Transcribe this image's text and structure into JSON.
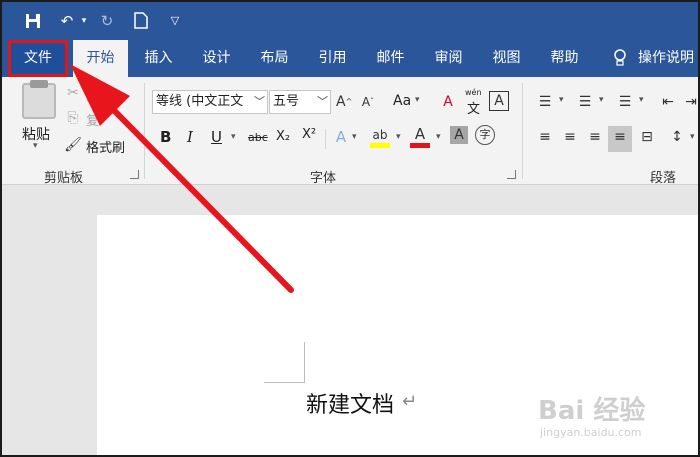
{
  "quick_access": {
    "save_icon": "save-icon",
    "undo_icon": "undo-icon",
    "redo_icon": "redo-icon",
    "new_icon": "new-document-icon",
    "customize_icon": "customize-qat-icon"
  },
  "tabs": [
    {
      "label": "文件",
      "active": false
    },
    {
      "label": "开始",
      "active": true
    },
    {
      "label": "插入",
      "active": false
    },
    {
      "label": "设计",
      "active": false
    },
    {
      "label": "布局",
      "active": false
    },
    {
      "label": "引用",
      "active": false
    },
    {
      "label": "邮件",
      "active": false
    },
    {
      "label": "审阅",
      "active": false
    },
    {
      "label": "视图",
      "active": false
    },
    {
      "label": "帮助",
      "active": false
    }
  ],
  "tell_me": {
    "label": "操作说明"
  },
  "clipboard": {
    "group_label": "剪贴板",
    "paste": "粘贴",
    "cut": "剪切",
    "copy": "复",
    "format_painter": "格式刷"
  },
  "font": {
    "group_label": "字体",
    "font_name": "等线 (中文正文",
    "font_size": "五号",
    "wen_label": "wén",
    "wen_char": "文",
    "case_label": "Aa",
    "bold": "B",
    "italic": "I",
    "underline": "U",
    "strikethrough": "abc",
    "subscript": "X₂",
    "superscript": "X²",
    "enclose_char": "字"
  },
  "paragraph": {
    "group_label": "段落"
  },
  "document": {
    "text": "新建文档"
  },
  "watermark": {
    "logo": "Bai 经验",
    "url": "jingyan.baidu.com"
  },
  "colors": {
    "title_bar": "#2b579a",
    "ribbon_bg": "#f3f3f3",
    "highlight_border": "#e0161b",
    "arrow": "#e8161c",
    "highlight_yellow": "#ffff00",
    "font_red": "#e0161b"
  }
}
